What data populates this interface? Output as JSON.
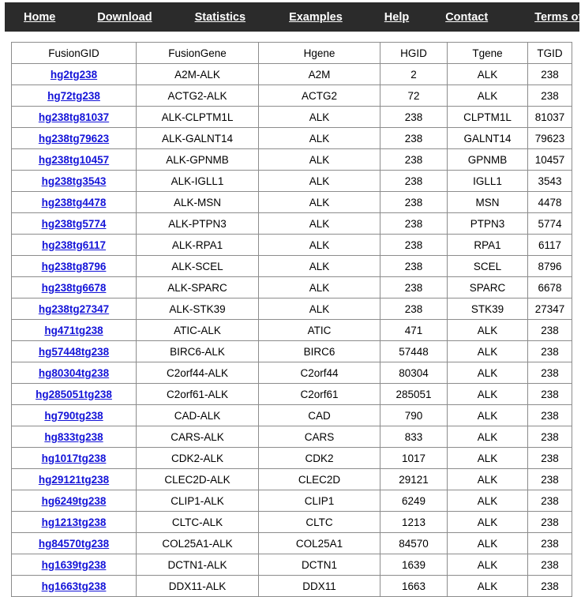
{
  "nav": {
    "items": [
      {
        "label": "Home"
      },
      {
        "label": "Download"
      },
      {
        "label": "Statistics"
      },
      {
        "label": "Examples"
      },
      {
        "label": "Help"
      },
      {
        "label": "Contact"
      },
      {
        "label": "Terms of Use"
      }
    ],
    "background_color": "#2b2b2b",
    "link_color": "#ffffff"
  },
  "table": {
    "link_color": "#1414d8",
    "border_color": "#8c8c8c",
    "columns": [
      "FusionGID",
      "FusionGene",
      "Hgene",
      "HGID",
      "Tgene",
      "TGID"
    ],
    "rows": [
      {
        "fusion_gid": "hg2tg238",
        "fusion_gene": "A2M-ALK",
        "hgene": "A2M",
        "hgid": "2",
        "tgene": "ALK",
        "tgid": "238"
      },
      {
        "fusion_gid": "hg72tg238",
        "fusion_gene": "ACTG2-ALK",
        "hgene": "ACTG2",
        "hgid": "72",
        "tgene": "ALK",
        "tgid": "238"
      },
      {
        "fusion_gid": "hg238tg81037",
        "fusion_gene": "ALK-CLPTM1L",
        "hgene": "ALK",
        "hgid": "238",
        "tgene": "CLPTM1L",
        "tgid": "81037"
      },
      {
        "fusion_gid": "hg238tg79623",
        "fusion_gene": "ALK-GALNT14",
        "hgene": "ALK",
        "hgid": "238",
        "tgene": "GALNT14",
        "tgid": "79623"
      },
      {
        "fusion_gid": "hg238tg10457",
        "fusion_gene": "ALK-GPNMB",
        "hgene": "ALK",
        "hgid": "238",
        "tgene": "GPNMB",
        "tgid": "10457"
      },
      {
        "fusion_gid": "hg238tg3543",
        "fusion_gene": "ALK-IGLL1",
        "hgene": "ALK",
        "hgid": "238",
        "tgene": "IGLL1",
        "tgid": "3543"
      },
      {
        "fusion_gid": "hg238tg4478",
        "fusion_gene": "ALK-MSN",
        "hgene": "ALK",
        "hgid": "238",
        "tgene": "MSN",
        "tgid": "4478"
      },
      {
        "fusion_gid": "hg238tg5774",
        "fusion_gene": "ALK-PTPN3",
        "hgene": "ALK",
        "hgid": "238",
        "tgene": "PTPN3",
        "tgid": "5774"
      },
      {
        "fusion_gid": "hg238tg6117",
        "fusion_gene": "ALK-RPA1",
        "hgene": "ALK",
        "hgid": "238",
        "tgene": "RPA1",
        "tgid": "6117"
      },
      {
        "fusion_gid": "hg238tg8796",
        "fusion_gene": "ALK-SCEL",
        "hgene": "ALK",
        "hgid": "238",
        "tgene": "SCEL",
        "tgid": "8796"
      },
      {
        "fusion_gid": "hg238tg6678",
        "fusion_gene": "ALK-SPARC",
        "hgene": "ALK",
        "hgid": "238",
        "tgene": "SPARC",
        "tgid": "6678"
      },
      {
        "fusion_gid": "hg238tg27347",
        "fusion_gene": "ALK-STK39",
        "hgene": "ALK",
        "hgid": "238",
        "tgene": "STK39",
        "tgid": "27347"
      },
      {
        "fusion_gid": "hg471tg238",
        "fusion_gene": "ATIC-ALK",
        "hgene": "ATIC",
        "hgid": "471",
        "tgene": "ALK",
        "tgid": "238"
      },
      {
        "fusion_gid": "hg57448tg238",
        "fusion_gene": "BIRC6-ALK",
        "hgene": "BIRC6",
        "hgid": "57448",
        "tgene": "ALK",
        "tgid": "238"
      },
      {
        "fusion_gid": "hg80304tg238",
        "fusion_gene": "C2orf44-ALK",
        "hgene": "C2orf44",
        "hgid": "80304",
        "tgene": "ALK",
        "tgid": "238"
      },
      {
        "fusion_gid": "hg285051tg238",
        "fusion_gene": "C2orf61-ALK",
        "hgene": "C2orf61",
        "hgid": "285051",
        "tgene": "ALK",
        "tgid": "238"
      },
      {
        "fusion_gid": "hg790tg238",
        "fusion_gene": "CAD-ALK",
        "hgene": "CAD",
        "hgid": "790",
        "tgene": "ALK",
        "tgid": "238"
      },
      {
        "fusion_gid": "hg833tg238",
        "fusion_gene": "CARS-ALK",
        "hgene": "CARS",
        "hgid": "833",
        "tgene": "ALK",
        "tgid": "238"
      },
      {
        "fusion_gid": "hg1017tg238",
        "fusion_gene": "CDK2-ALK",
        "hgene": "CDK2",
        "hgid": "1017",
        "tgene": "ALK",
        "tgid": "238"
      },
      {
        "fusion_gid": "hg29121tg238",
        "fusion_gene": "CLEC2D-ALK",
        "hgene": "CLEC2D",
        "hgid": "29121",
        "tgene": "ALK",
        "tgid": "238"
      },
      {
        "fusion_gid": "hg6249tg238",
        "fusion_gene": "CLIP1-ALK",
        "hgene": "CLIP1",
        "hgid": "6249",
        "tgene": "ALK",
        "tgid": "238"
      },
      {
        "fusion_gid": "hg1213tg238",
        "fusion_gene": "CLTC-ALK",
        "hgene": "CLTC",
        "hgid": "1213",
        "tgene": "ALK",
        "tgid": "238"
      },
      {
        "fusion_gid": "hg84570tg238",
        "fusion_gene": "COL25A1-ALK",
        "hgene": "COL25A1",
        "hgid": "84570",
        "tgene": "ALK",
        "tgid": "238"
      },
      {
        "fusion_gid": "hg1639tg238",
        "fusion_gene": "DCTN1-ALK",
        "hgene": "DCTN1",
        "hgid": "1639",
        "tgene": "ALK",
        "tgid": "238"
      },
      {
        "fusion_gid": "hg1663tg238",
        "fusion_gene": "DDX11-ALK",
        "hgene": "DDX11",
        "hgid": "1663",
        "tgene": "ALK",
        "tgid": "238"
      }
    ]
  }
}
